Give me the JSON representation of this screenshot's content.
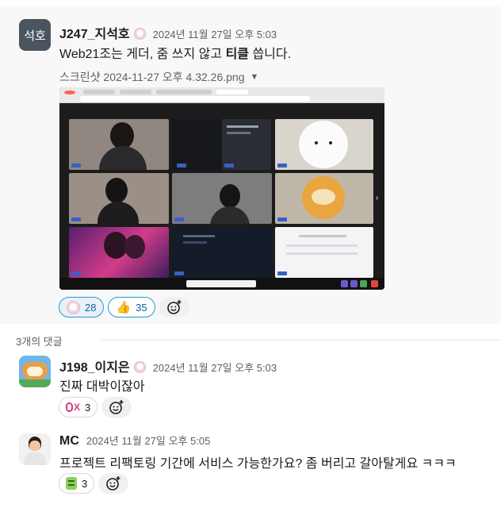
{
  "parent": {
    "avatar_text": "석호",
    "author": "J247_지석호",
    "timestamp": "2024년 11월 27일 오후 5:03",
    "text_before": "Web21조는 게더, 줌 쓰지 않고 ",
    "text_bold": "티클",
    "text_after": " 씁니다.",
    "attachment_name": "스크린샷 2024-11-27 오후 4.32.26.png",
    "caret": "▼",
    "reactions": [
      {
        "icon": "custom-face-emoji",
        "count": "28",
        "active": true
      },
      {
        "icon": "thumbs-up-emoji",
        "count": "35",
        "active": false
      }
    ]
  },
  "replies_label": "3개의 댓글",
  "replies": [
    {
      "author": "J198_이지은",
      "timestamp": "2024년 11월 27일 오후 5:03",
      "text": "진짜 대박이잖아",
      "reaction_count": "3",
      "reaction_icon": "ox-emoji"
    },
    {
      "author": "MC",
      "timestamp": "2024년 11월 27일 오후 5:05",
      "text": "프로젝트 리팩토링 기간에 서비스 가능한가요? 좀 버리고 갈아탈게요 ㅋㅋㅋ",
      "reaction_count": "3",
      "reaction_icon": "green-emoji"
    }
  ],
  "colors": {
    "link_blue": "#1264a3",
    "active_reaction_bg": "#e8f1fa",
    "avatar_bg": "#4a5560"
  }
}
